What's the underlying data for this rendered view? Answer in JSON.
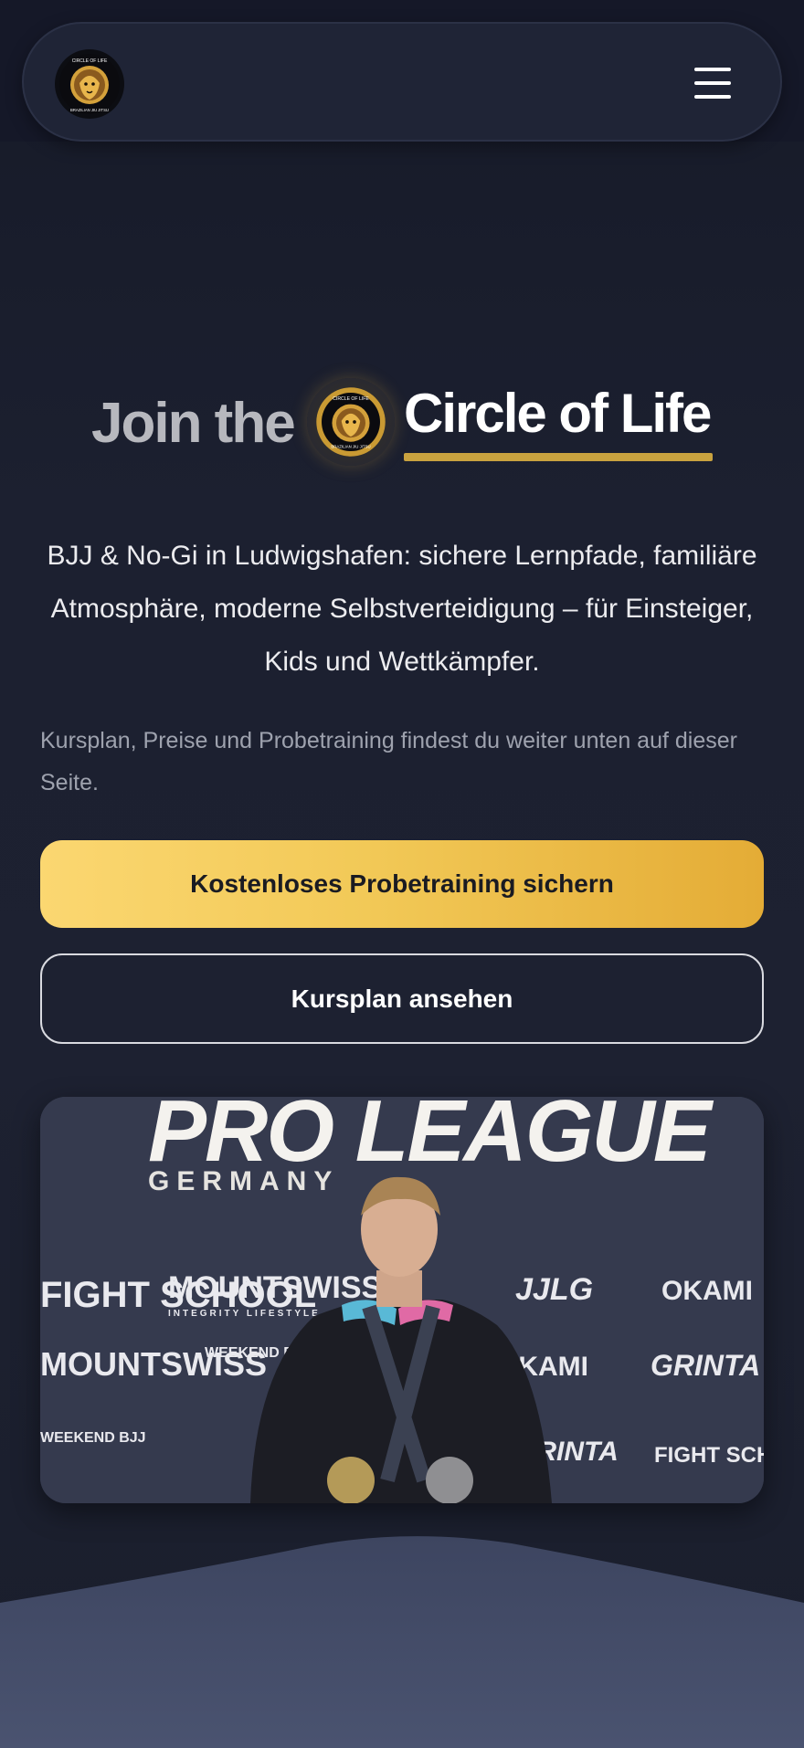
{
  "header": {
    "logo_alt": "Circle of Life Brazilian Jiu Jitsu",
    "logo_text_top": "CIRCLE OF LIFE",
    "logo_text_bottom": "BRAZILIAN JIU JITSU",
    "menu_icon": "hamburger-menu-icon"
  },
  "hero": {
    "title_prefix": "Join the",
    "title_brand": "Circle of Life",
    "lead": "BJJ & No-Gi in Ludwigshafen: sichere Lernpfade, familiäre Atmosphäre, moderne Selbstverteidigung – für Einsteiger, Kids und Wettkämpfer.",
    "note": "Kursplan, Preise und Probetraining findest du weiter unten auf dieser Seite.",
    "cta_primary": "Kostenloses Probetraining sichern",
    "cta_secondary": "Kursplan ansehen"
  },
  "photo": {
    "banner_title": "PRO LEAGUE",
    "banner_sub": "GERMANY",
    "sponsors": [
      "FIGHT SCHOOL",
      "MOUNTSWISS",
      "INTEGRITY LIFESTYLE",
      "WEEKEND BJJ",
      "JJLG",
      "OKAMI",
      "GRINTA"
    ]
  },
  "colors": {
    "accent_gold": "#f2c957",
    "underline_gold": "#c9a23f",
    "background": "#191d2c",
    "wave": "#414a66"
  }
}
